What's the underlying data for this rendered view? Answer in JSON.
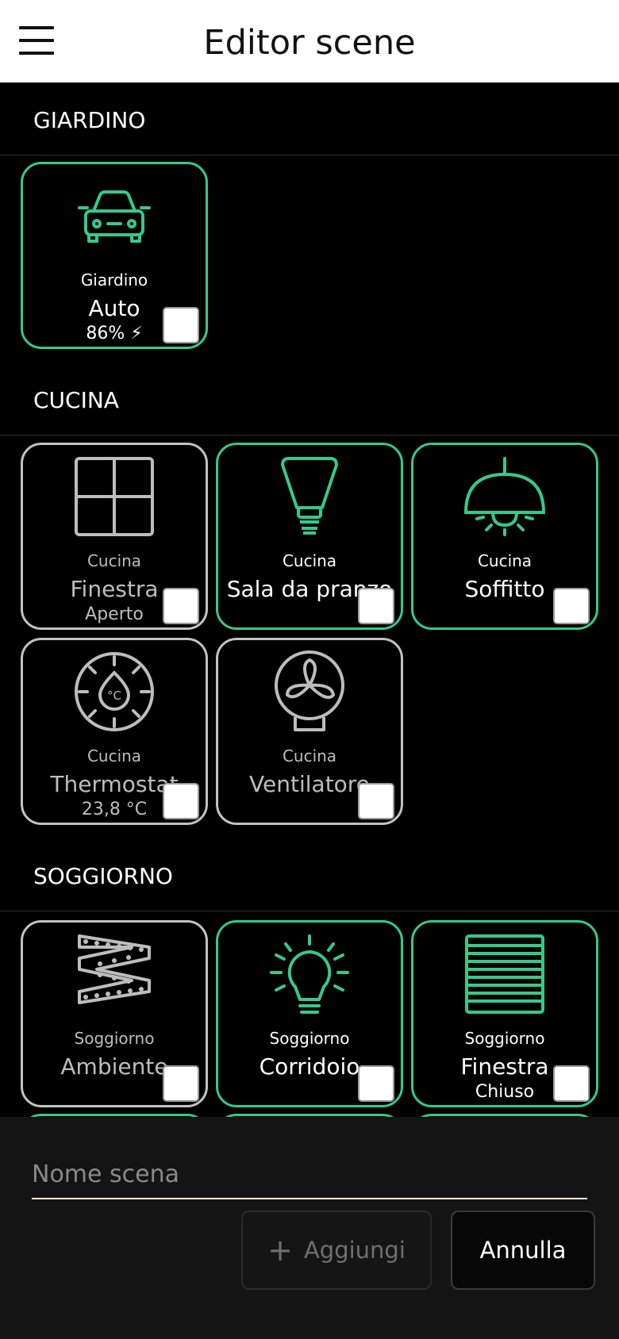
{
  "header": {
    "title": "Editor scene",
    "menu_icon": "menu-icon"
  },
  "colors": {
    "active": "#35c98a",
    "inactive": "#c2c2c2",
    "background": "#000000"
  },
  "sections": {
    "giardino": {
      "label": "GIARDINO",
      "tiles": [
        {
          "room": "Giardino",
          "name": "Auto",
          "status": "86% ⚡",
          "icon": "car-icon",
          "active": true,
          "checked": false
        }
      ]
    },
    "cucina": {
      "label": "CUCINA",
      "tiles": [
        {
          "room": "Cucina",
          "name": "Finestra",
          "status": "Aperto",
          "icon": "window-icon",
          "active": false,
          "checked": false
        },
        {
          "room": "Cucina",
          "name": "Sala da pranzo",
          "status": "",
          "icon": "spot-bulb-icon",
          "active": true,
          "checked": false
        },
        {
          "room": "Cucina",
          "name": "Soffitto",
          "status": "",
          "icon": "ceiling-lamp-icon",
          "active": true,
          "checked": false
        },
        {
          "room": "Cucina",
          "name": "Thermostat",
          "status": "23,8 °C",
          "icon": "thermostat-icon",
          "active": false,
          "checked": false
        },
        {
          "room": "Cucina",
          "name": "Ventilatore",
          "status": "",
          "icon": "fan-icon",
          "active": false,
          "checked": false
        }
      ]
    },
    "soggiorno": {
      "label": "SOGGIORNO",
      "tiles": [
        {
          "room": "Soggiorno",
          "name": "Ambiente",
          "status": "",
          "icon": "led-strip-icon",
          "active": false,
          "checked": false
        },
        {
          "room": "Soggiorno",
          "name": "Corridoio",
          "status": "",
          "icon": "light-bulb-icon",
          "active": true,
          "checked": false
        },
        {
          "room": "Soggiorno",
          "name": "Finestra",
          "status": "Chiuso",
          "icon": "blinds-icon",
          "active": true,
          "checked": false
        }
      ]
    }
  },
  "footer": {
    "scene_name_placeholder": "Nome scena",
    "scene_name_value": "",
    "add_label": "Aggiungi",
    "add_icon": "plus-icon",
    "cancel_label": "Annulla"
  }
}
